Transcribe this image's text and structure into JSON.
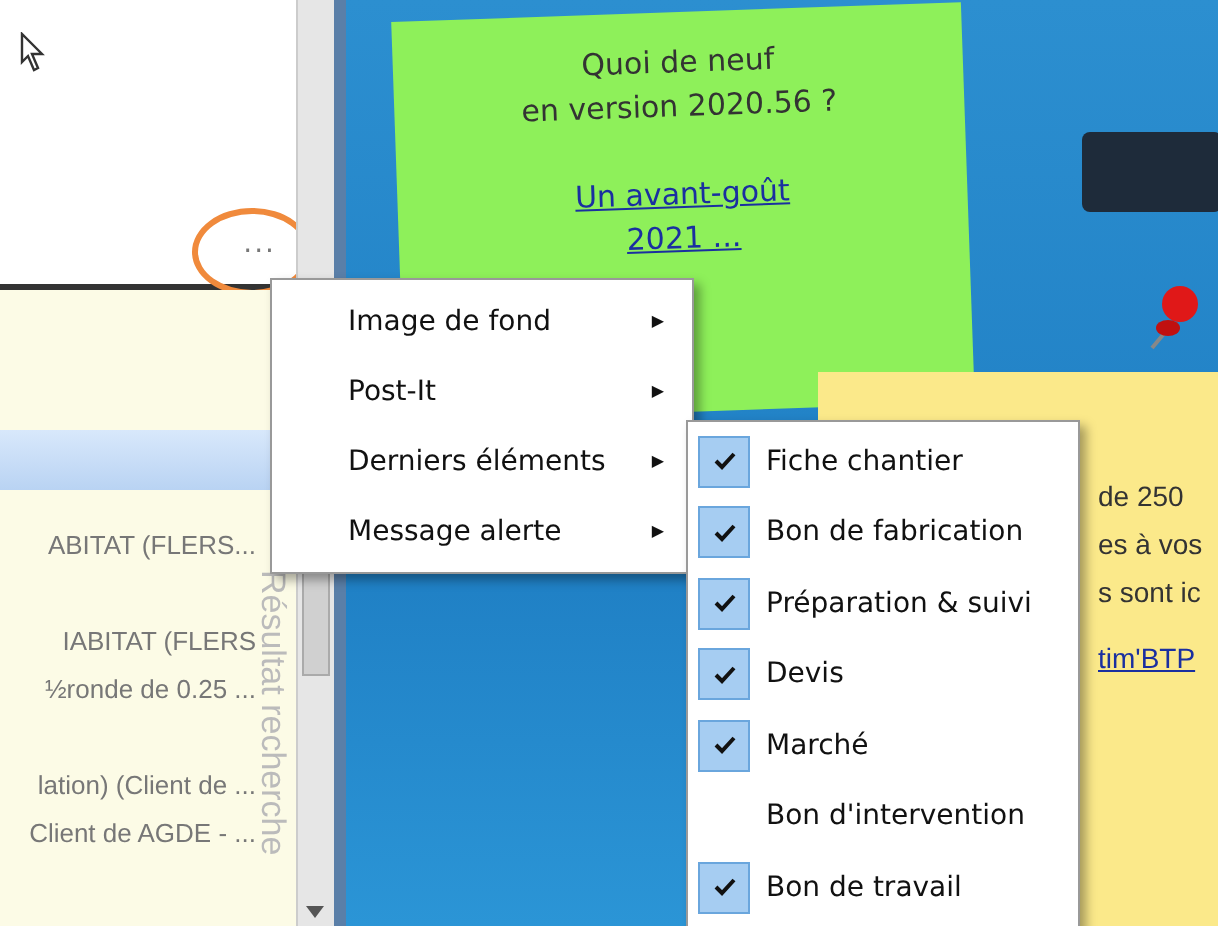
{
  "left_panel": {
    "more_button": "...",
    "side_label": "Résultat recherche",
    "rows": [
      {
        "text": "ABITAT (FLERS..."
      },
      {
        "text": "IABITAT (FLERS"
      },
      {
        "text": "½ronde de 0.25 ..."
      },
      {
        "text": "lation) (Client de ..."
      },
      {
        "text": "Client de AGDE - ..."
      }
    ]
  },
  "green_note": {
    "lines": [
      "Quoi de neuf",
      "en version 2020.56 ?"
    ],
    "link_lines": [
      "Un avant-goût",
      "2021 ..."
    ]
  },
  "yellow_note": {
    "lines": [
      "de 250",
      "es à vos",
      "s sont ic"
    ],
    "link": "tim'BTP"
  },
  "context_menu": [
    {
      "label": "Image de fond",
      "arrow": "▶"
    },
    {
      "label": "Post-It",
      "arrow": "▶"
    },
    {
      "label": "Derniers éléments",
      "arrow": "▶"
    },
    {
      "label": "Message alerte",
      "arrow": "▶"
    }
  ],
  "submenu": [
    {
      "label": "Fiche chantier",
      "checked": true
    },
    {
      "label": "Bon de fabrication",
      "checked": true
    },
    {
      "label": "Préparation & suivi",
      "checked": true
    },
    {
      "label": "Devis",
      "checked": true
    },
    {
      "label": "Marché",
      "checked": true
    },
    {
      "label": "Bon d'intervention",
      "checked": false
    },
    {
      "label": "Bon de travail",
      "checked": true
    }
  ]
}
